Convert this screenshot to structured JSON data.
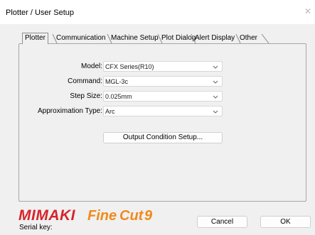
{
  "window": {
    "title": "Plotter / User Setup"
  },
  "tabs": [
    {
      "label": "Plotter",
      "active": true
    },
    {
      "label": "Communication",
      "active": false
    },
    {
      "label": "Machine Setup",
      "active": false
    },
    {
      "label": "Plot Dialog",
      "active": false
    },
    {
      "label": "Alert Display",
      "active": false
    },
    {
      "label": "Other",
      "active": false
    }
  ],
  "form": {
    "model": {
      "label": "Model:",
      "value": "CFX Series(R10)"
    },
    "command": {
      "label": "Command:",
      "value": "MGL-3c"
    },
    "step_size": {
      "label": "Step Size:",
      "value": "0.025mm"
    },
    "approximation_type": {
      "label": "Approximation Type:",
      "value": "Arc"
    },
    "output_condition_button": "Output Condition Setup..."
  },
  "footer": {
    "brand": "MIMAKI",
    "product": "FineCut9",
    "serial_label": "Serial key:",
    "cancel_label": "Cancel",
    "ok_label": "OK"
  },
  "colors": {
    "brand_red": "#d7232a",
    "product_orange": "#f08a1b"
  }
}
